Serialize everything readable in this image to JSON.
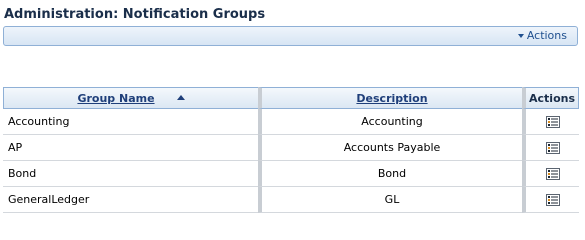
{
  "page": {
    "title": "Administration: Notification Groups"
  },
  "toolbar": {
    "actions_label": "Actions"
  },
  "table": {
    "columns": {
      "group_name": "Group Name",
      "description": "Description",
      "actions": "Actions"
    },
    "sort": {
      "column": "group_name",
      "direction": "ascending"
    },
    "rows": [
      {
        "group_name": "Accounting",
        "description": "Accounting"
      },
      {
        "group_name": "AP",
        "description": "Accounts Payable"
      },
      {
        "group_name": "Bond",
        "description": "Bond"
      },
      {
        "group_name": "GeneralLedger",
        "description": "GL"
      }
    ],
    "row_action_icon": "list-menu-icon"
  },
  "colors": {
    "accent": "#1f3f7a",
    "bar_border": "#8fb0d6",
    "header_bg": "#dbe7f3"
  }
}
